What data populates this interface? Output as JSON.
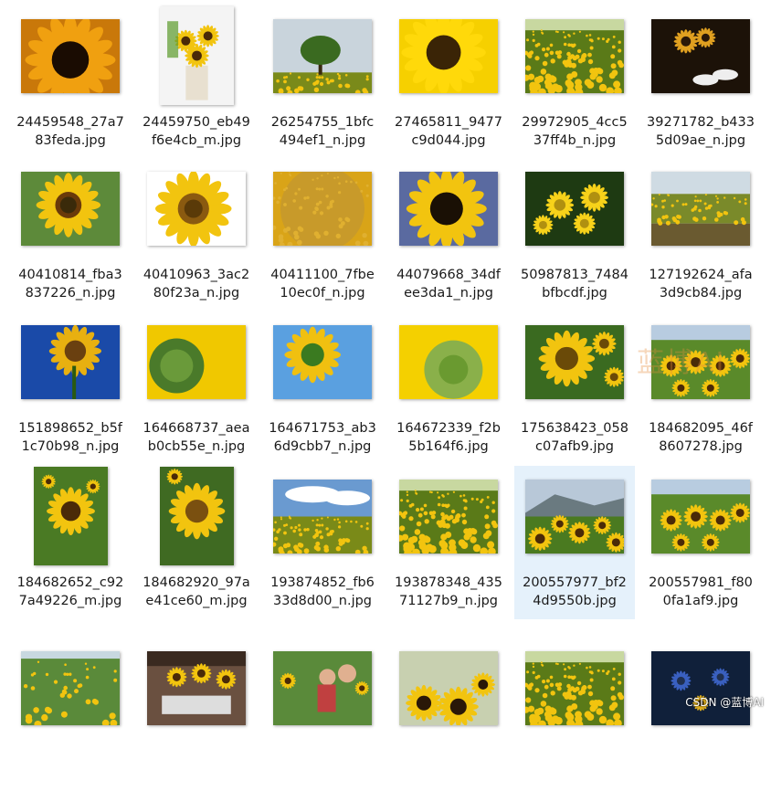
{
  "files": [
    {
      "name": "24459548_27a7\n83feda.jpg",
      "orient": "landscape",
      "scene": "closeup-dark",
      "icon": "image-thumbnail-icon"
    },
    {
      "name": "24459750_eb49\nf6e4cb_m.jpg",
      "orient": "portrait",
      "scene": "bouquet",
      "icon": "image-thumbnail-icon"
    },
    {
      "name": "26254755_1bfc\n494ef1_n.jpg",
      "orient": "landscape",
      "scene": "tree-field",
      "icon": "image-thumbnail-icon"
    },
    {
      "name": "27465811_9477\nc9d044.jpg",
      "orient": "landscape",
      "scene": "petals",
      "icon": "image-thumbnail-icon"
    },
    {
      "name": "29972905_4cc5\n37ff4b_n.jpg",
      "orient": "landscape",
      "scene": "dense-field",
      "icon": "image-thumbnail-icon"
    },
    {
      "name": "39271782_b433\n5d09ae_n.jpg",
      "orient": "landscape",
      "scene": "dark-table",
      "icon": "image-thumbnail-icon"
    },
    {
      "name": "40410814_fba3\n837226_n.jpg",
      "orient": "landscape",
      "scene": "flower-green",
      "icon": "image-thumbnail-icon"
    },
    {
      "name": "40410963_3ac2\n80f23a_n.jpg",
      "orient": "landscape",
      "scene": "flower-white",
      "icon": "image-thumbnail-icon"
    },
    {
      "name": "40411100_7fbe\n10ec0f_n.jpg",
      "orient": "landscape",
      "scene": "disc-macro",
      "icon": "image-thumbnail-icon"
    },
    {
      "name": "44079668_34df\nee3da1_n.jpg",
      "orient": "landscape",
      "scene": "flower-sky",
      "icon": "image-thumbnail-icon"
    },
    {
      "name": "50987813_7484\nbfbcdf.jpg",
      "orient": "landscape",
      "scene": "daisies",
      "icon": "image-thumbnail-icon"
    },
    {
      "name": "127192624_afa\n3d9cb84.jpg",
      "orient": "landscape",
      "scene": "far-field",
      "icon": "image-thumbnail-icon"
    },
    {
      "name": "151898652_b5f\n1c70b98_n.jpg",
      "orient": "landscape",
      "scene": "flower-blue",
      "icon": "image-thumbnail-icon"
    },
    {
      "name": "164668737_aea\nb0cb55e_n.jpg",
      "orient": "landscape",
      "scene": "bud-yellow",
      "icon": "image-thumbnail-icon"
    },
    {
      "name": "164671753_ab3\n6d9cbb7_n.jpg",
      "orient": "landscape",
      "scene": "side-blue",
      "icon": "image-thumbnail-icon"
    },
    {
      "name": "164672339_f2b\n5b164f6.jpg",
      "orient": "landscape",
      "scene": "back-yellow",
      "icon": "image-thumbnail-icon"
    },
    {
      "name": "175638423_058\nc07afb9.jpg",
      "orient": "landscape",
      "scene": "cluster",
      "icon": "image-thumbnail-icon"
    },
    {
      "name": "184682095_46f\n8607278.jpg",
      "orient": "landscape",
      "scene": "row-field",
      "icon": "image-thumbnail-icon"
    },
    {
      "name": "184682652_c92\n7a49226_m.jpg",
      "orient": "portrait",
      "scene": "portrait-field",
      "icon": "image-thumbnail-icon"
    },
    {
      "name": "184682920_97a\ne41ce60_m.jpg",
      "orient": "portrait",
      "scene": "portrait-flower",
      "icon": "image-thumbnail-icon"
    },
    {
      "name": "193874852_fb6\n33d8d00_n.jpg",
      "orient": "landscape",
      "scene": "cloud-field",
      "icon": "image-thumbnail-icon"
    },
    {
      "name": "193878348_435\n71127b9_n.jpg",
      "orient": "landscape",
      "scene": "dense-field",
      "icon": "image-thumbnail-icon"
    },
    {
      "name": "200557977_bf2\n4d9550b.jpg",
      "orient": "landscape",
      "scene": "mountain-field",
      "icon": "image-thumbnail-icon",
      "selected": true
    },
    {
      "name": "200557981_f80\n0fa1af9.jpg",
      "orient": "landscape",
      "scene": "row-field",
      "icon": "image-thumbnail-icon"
    },
    {
      "name": "",
      "orient": "landscape",
      "scene": "green-field",
      "icon": "image-thumbnail-icon"
    },
    {
      "name": "",
      "orient": "landscape",
      "scene": "market",
      "icon": "image-thumbnail-icon"
    },
    {
      "name": "",
      "orient": "landscape",
      "scene": "people",
      "icon": "image-thumbnail-icon"
    },
    {
      "name": "",
      "orient": "landscape",
      "scene": "blur-flowers",
      "icon": "image-thumbnail-icon"
    },
    {
      "name": "",
      "orient": "landscape",
      "scene": "dense-field",
      "icon": "image-thumbnail-icon"
    },
    {
      "name": "",
      "orient": "landscape",
      "scene": "night-blue",
      "icon": "image-thumbnail-icon"
    }
  ],
  "overlay": {
    "watermark": "蓝博AI",
    "credit": "CSDN @蓝博AI"
  }
}
